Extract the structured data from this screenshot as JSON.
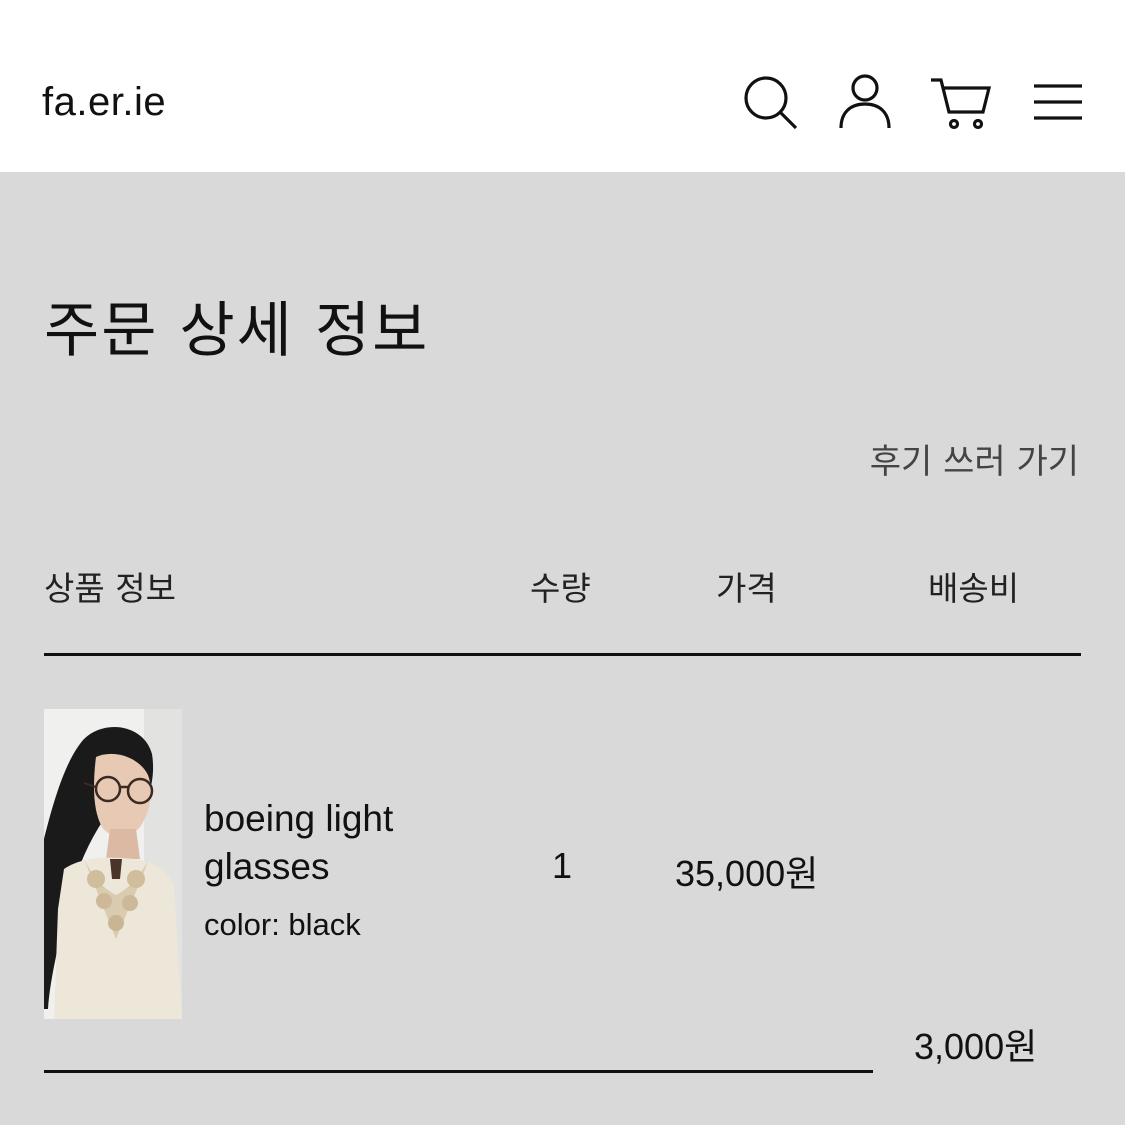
{
  "header": {
    "logo": "fa.er.ie",
    "icons": [
      "search-icon",
      "user-icon",
      "cart-icon",
      "menu-icon"
    ]
  },
  "page": {
    "title": "주문 상세 정보",
    "review_link": "후기 쓰러 가기"
  },
  "table": {
    "columns": {
      "product": "상품 정보",
      "quantity": "수량",
      "price": "가격",
      "shipping": "배송비"
    },
    "rows": [
      {
        "name": "boeing light glasses",
        "option": "color: black",
        "quantity": "1",
        "price": "35,000원",
        "shipping": "3,000원"
      }
    ]
  },
  "colors": {
    "background": "#d9d9d9",
    "header": "#ffffff",
    "text": "#111111"
  }
}
